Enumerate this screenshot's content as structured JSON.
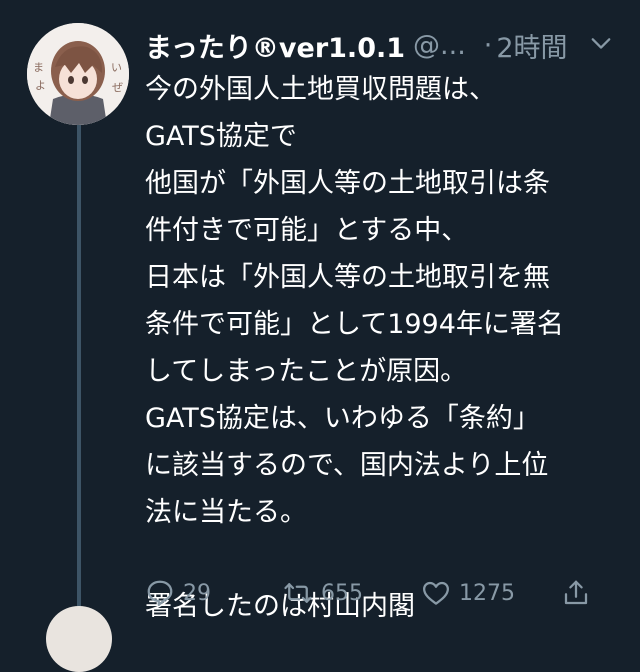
{
  "tweet": {
    "display_name": "まったり®ver1.0.1",
    "handle": "@...",
    "separator": "·",
    "time": "2時間",
    "lines": [
      "今の外国人土地買収問題は、",
      "GATS協定で",
      "他国が「外国人等の土地取引は条",
      "件付きで可能」とする中、",
      "日本は「外国人等の土地取引を無",
      "条件で可能」として1994年に署名",
      "してしまったことが原因。",
      "GATS協定は、いわゆる「条約」",
      "に該当するので、国内法より上位",
      "法に当たる。",
      "",
      "署名したのは村山内閣"
    ],
    "actions": {
      "reply_count": "29",
      "retweet_count": "655",
      "like_count": "1275"
    }
  },
  "colors": {
    "background": "#15202b",
    "text": "#ffffff",
    "secondary": "#8899a6",
    "thread_line": "#3d5466"
  },
  "icons": [
    "chevron-down-icon",
    "reply-icon",
    "retweet-icon",
    "like-icon",
    "share-icon"
  ]
}
